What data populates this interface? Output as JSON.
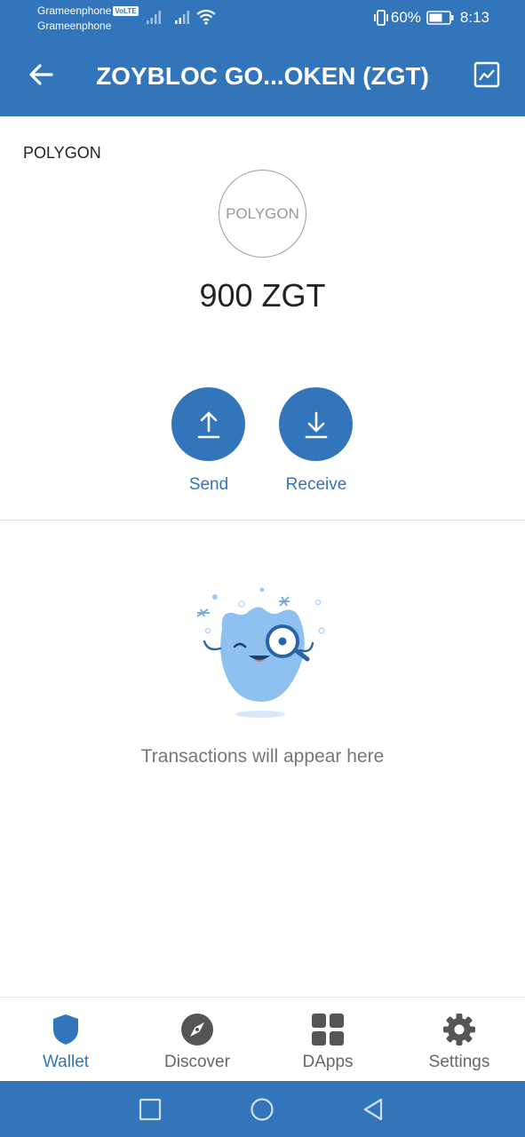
{
  "status_bar": {
    "carrier_1": "Grameenphone",
    "volte_badge": "VoLTE",
    "carrier_2": "Grameenphone",
    "battery_percent": "60%",
    "time": "8:13"
  },
  "header": {
    "title": "ZOYBLOC GO...OKEN (ZGT)",
    "back_icon": "arrow-left",
    "chart_icon": "line-chart"
  },
  "asset": {
    "network_label": "POLYGON",
    "coin_logo_text": "POLYGON",
    "balance": "900 ZGT"
  },
  "actions": {
    "send_label": "Send",
    "receive_label": "Receive"
  },
  "transactions": {
    "empty_text": "Transactions will appear here"
  },
  "bottom_nav": {
    "items": [
      {
        "label": "Wallet",
        "icon": "shield",
        "active": true
      },
      {
        "label": "Discover",
        "icon": "compass",
        "active": false
      },
      {
        "label": "DApps",
        "icon": "grid",
        "active": false
      },
      {
        "label": "Settings",
        "icon": "gear",
        "active": false
      }
    ]
  },
  "colors": {
    "accent": "#3375bb",
    "text_primary": "#222222",
    "text_muted": "#777777"
  }
}
